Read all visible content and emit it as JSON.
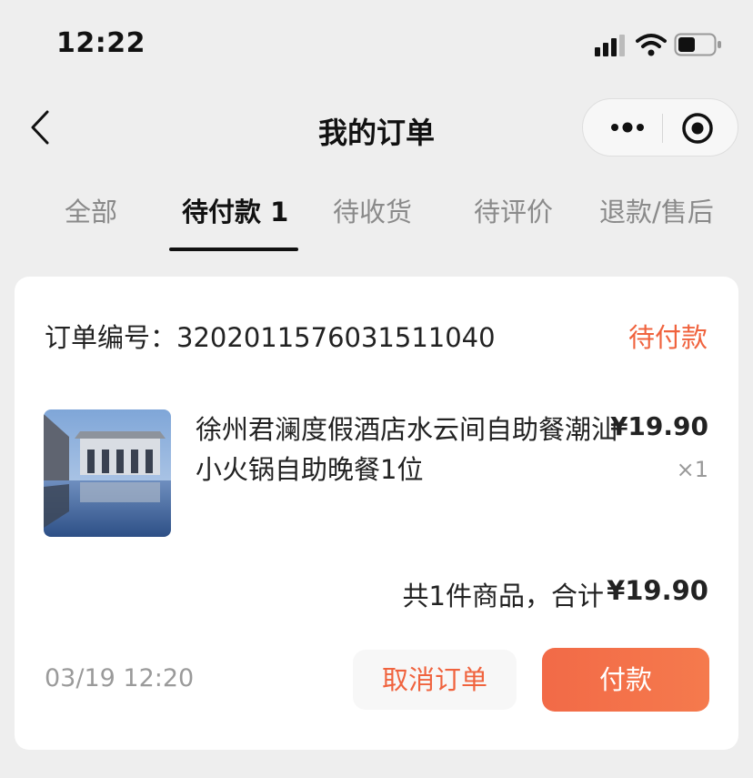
{
  "status_bar": {
    "time": "12:22"
  },
  "nav": {
    "title": "我的订单"
  },
  "tabs": [
    {
      "label": "全部"
    },
    {
      "label": "待付款 1"
    },
    {
      "label": "待收货"
    },
    {
      "label": "待评价"
    },
    {
      "label": "退款/售后"
    }
  ],
  "active_tab": "待付款 1",
  "order": {
    "number_label": "订单编号：",
    "number": "3202011576031511040",
    "status": "待付款",
    "product": {
      "name": "徐州君澜度假酒店水云间自助餐潮汕小火锅自助晚餐1位",
      "price": "¥19.90",
      "quantity": "×1"
    },
    "summary_label": "共1件商品，合计",
    "total": "¥19.90",
    "time": "03/19 12:20",
    "cancel_label": "取消订单",
    "pay_label": "付款"
  },
  "colors": {
    "accent": "#f0633e",
    "background": "#eeeeee"
  }
}
